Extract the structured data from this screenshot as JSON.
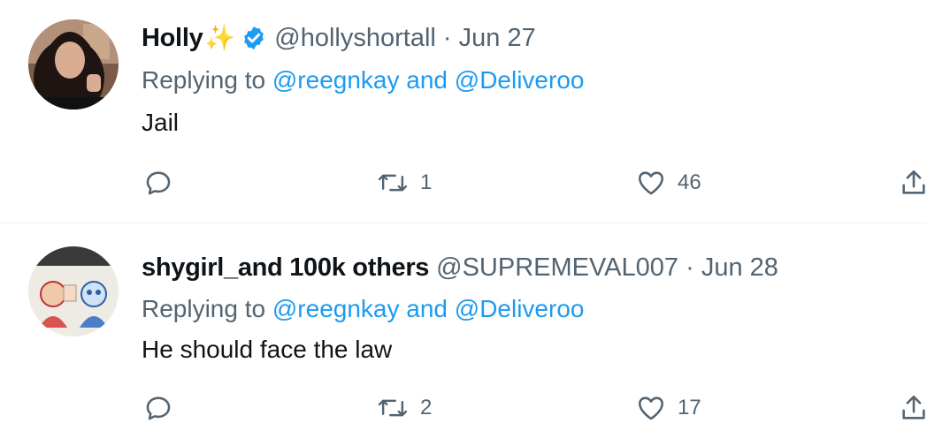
{
  "tweets": [
    {
      "name": "Holly",
      "name_emoji": "✨",
      "verified": true,
      "handle": "@hollyshortall",
      "separator": "·",
      "date": "Jun 27",
      "replying_prefix": "Replying to",
      "replying_user1": "@reegnkay",
      "replying_and": "and",
      "replying_user2": "@Deliveroo",
      "text": "Jail",
      "retweets": "1",
      "likes": "46"
    },
    {
      "name": "shygirl_and 100k others",
      "handle": "@SUPREMEVAL007",
      "separator": "·",
      "date": "Jun 28",
      "replying_prefix": "Replying to",
      "replying_user1": "@reegnkay",
      "replying_and": "and",
      "replying_user2": "@Deliveroo",
      "text": "He should face the law",
      "retweets": "2",
      "likes": "17"
    }
  ],
  "colors": {
    "link": "#1d9bf0",
    "secondary_text": "#536471",
    "primary_text": "#0f1419",
    "verified_badge": "#1d9bf0",
    "sparkle": "#f4c542"
  },
  "icons": [
    "reply-icon",
    "retweet-icon",
    "like-icon",
    "share-icon",
    "verified-badge-icon",
    "sparkles-icon"
  ]
}
